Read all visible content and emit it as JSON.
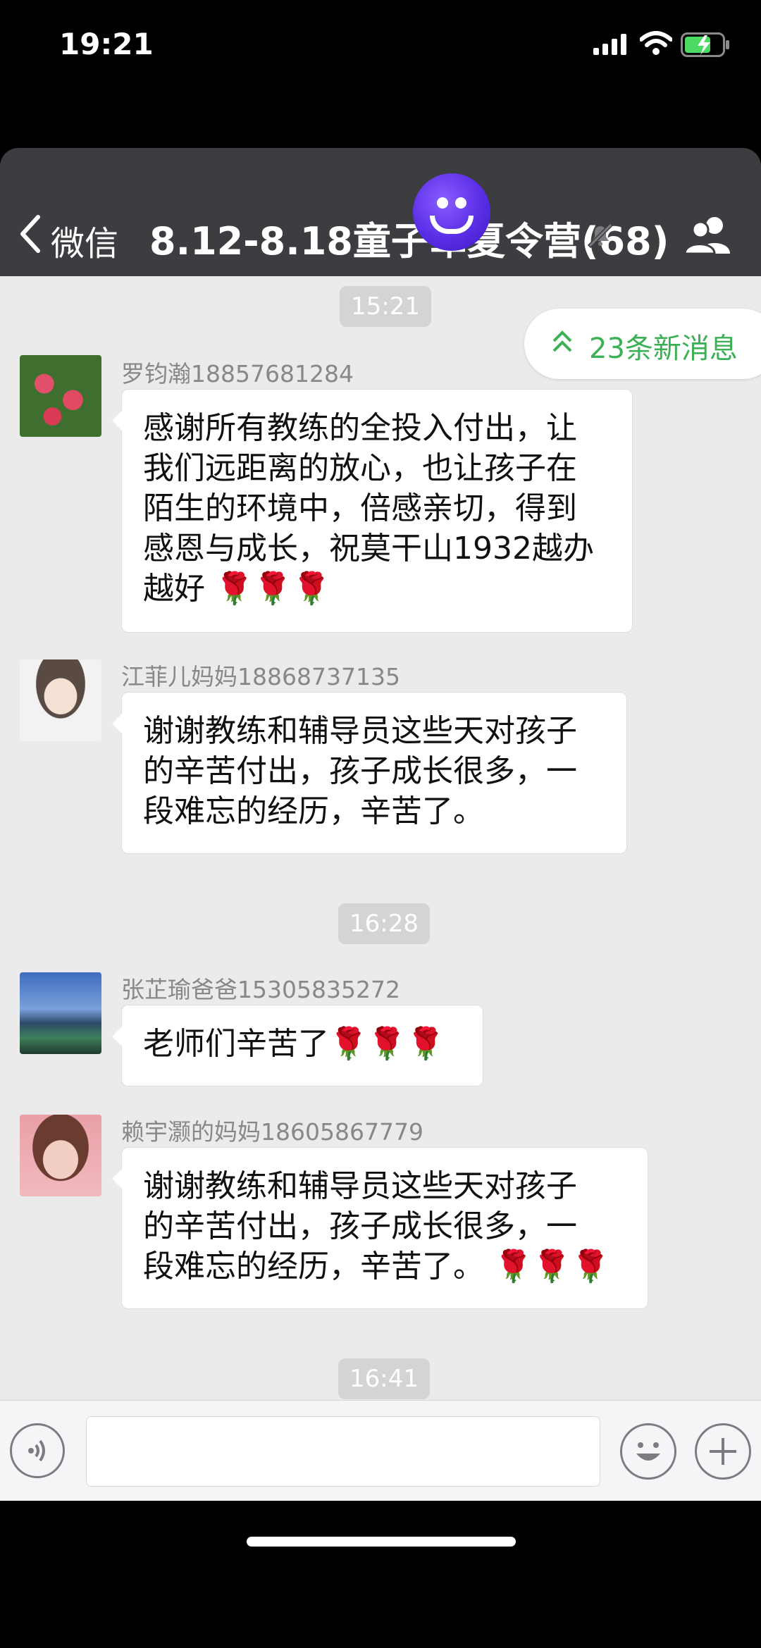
{
  "status_bar": {
    "time": "19:21"
  },
  "header": {
    "back_label": "微信",
    "title": "8.12-8.18童子军夏令营(68)"
  },
  "new_messages_badge": "23条新消息",
  "timestamps": [
    "15:21",
    "16:28",
    "16:41"
  ],
  "messages": [
    {
      "sender": "罗钧瀚18857681284",
      "lines": [
        "感谢所有教练的全投入付出，让",
        "我们远距离的放心，也让孩子在",
        "陌生的环境中，倍感亲切，得到",
        "感恩与成长，祝莫干山1932越办"
      ],
      "last_line": "越好",
      "emoji": "🌹🌹🌹"
    },
    {
      "sender": "江菲儿妈妈18868737135",
      "lines": [
        "谢谢教练和辅导员这些天对孩子",
        "的辛苦付出，孩子成长很多，一",
        "段难忘的经历，辛苦了。"
      ]
    },
    {
      "sender": "张芷瑜爸爸15305835272",
      "text": "老师们辛苦了",
      "emoji": "🌹🌹🌹"
    },
    {
      "sender": "赖宇灏的妈妈18605867779",
      "lines": [
        "谢谢教练和辅导员这些天对孩子",
        "的辛苦付出，孩子成长很多，一"
      ],
      "last_line": "段难忘的经历，辛苦了。",
      "emoji": "🌹🌹🌹"
    }
  ],
  "colors": {
    "nav_bg": "#3c3d41",
    "chat_bg": "#ebebeb",
    "accent_green": "#3cb054"
  },
  "icons": [
    "back-chevron-icon",
    "mute-bell-icon",
    "group-members-icon",
    "voice-icon",
    "emoji-icon",
    "plus-icon",
    "double-chevron-up-icon"
  ]
}
